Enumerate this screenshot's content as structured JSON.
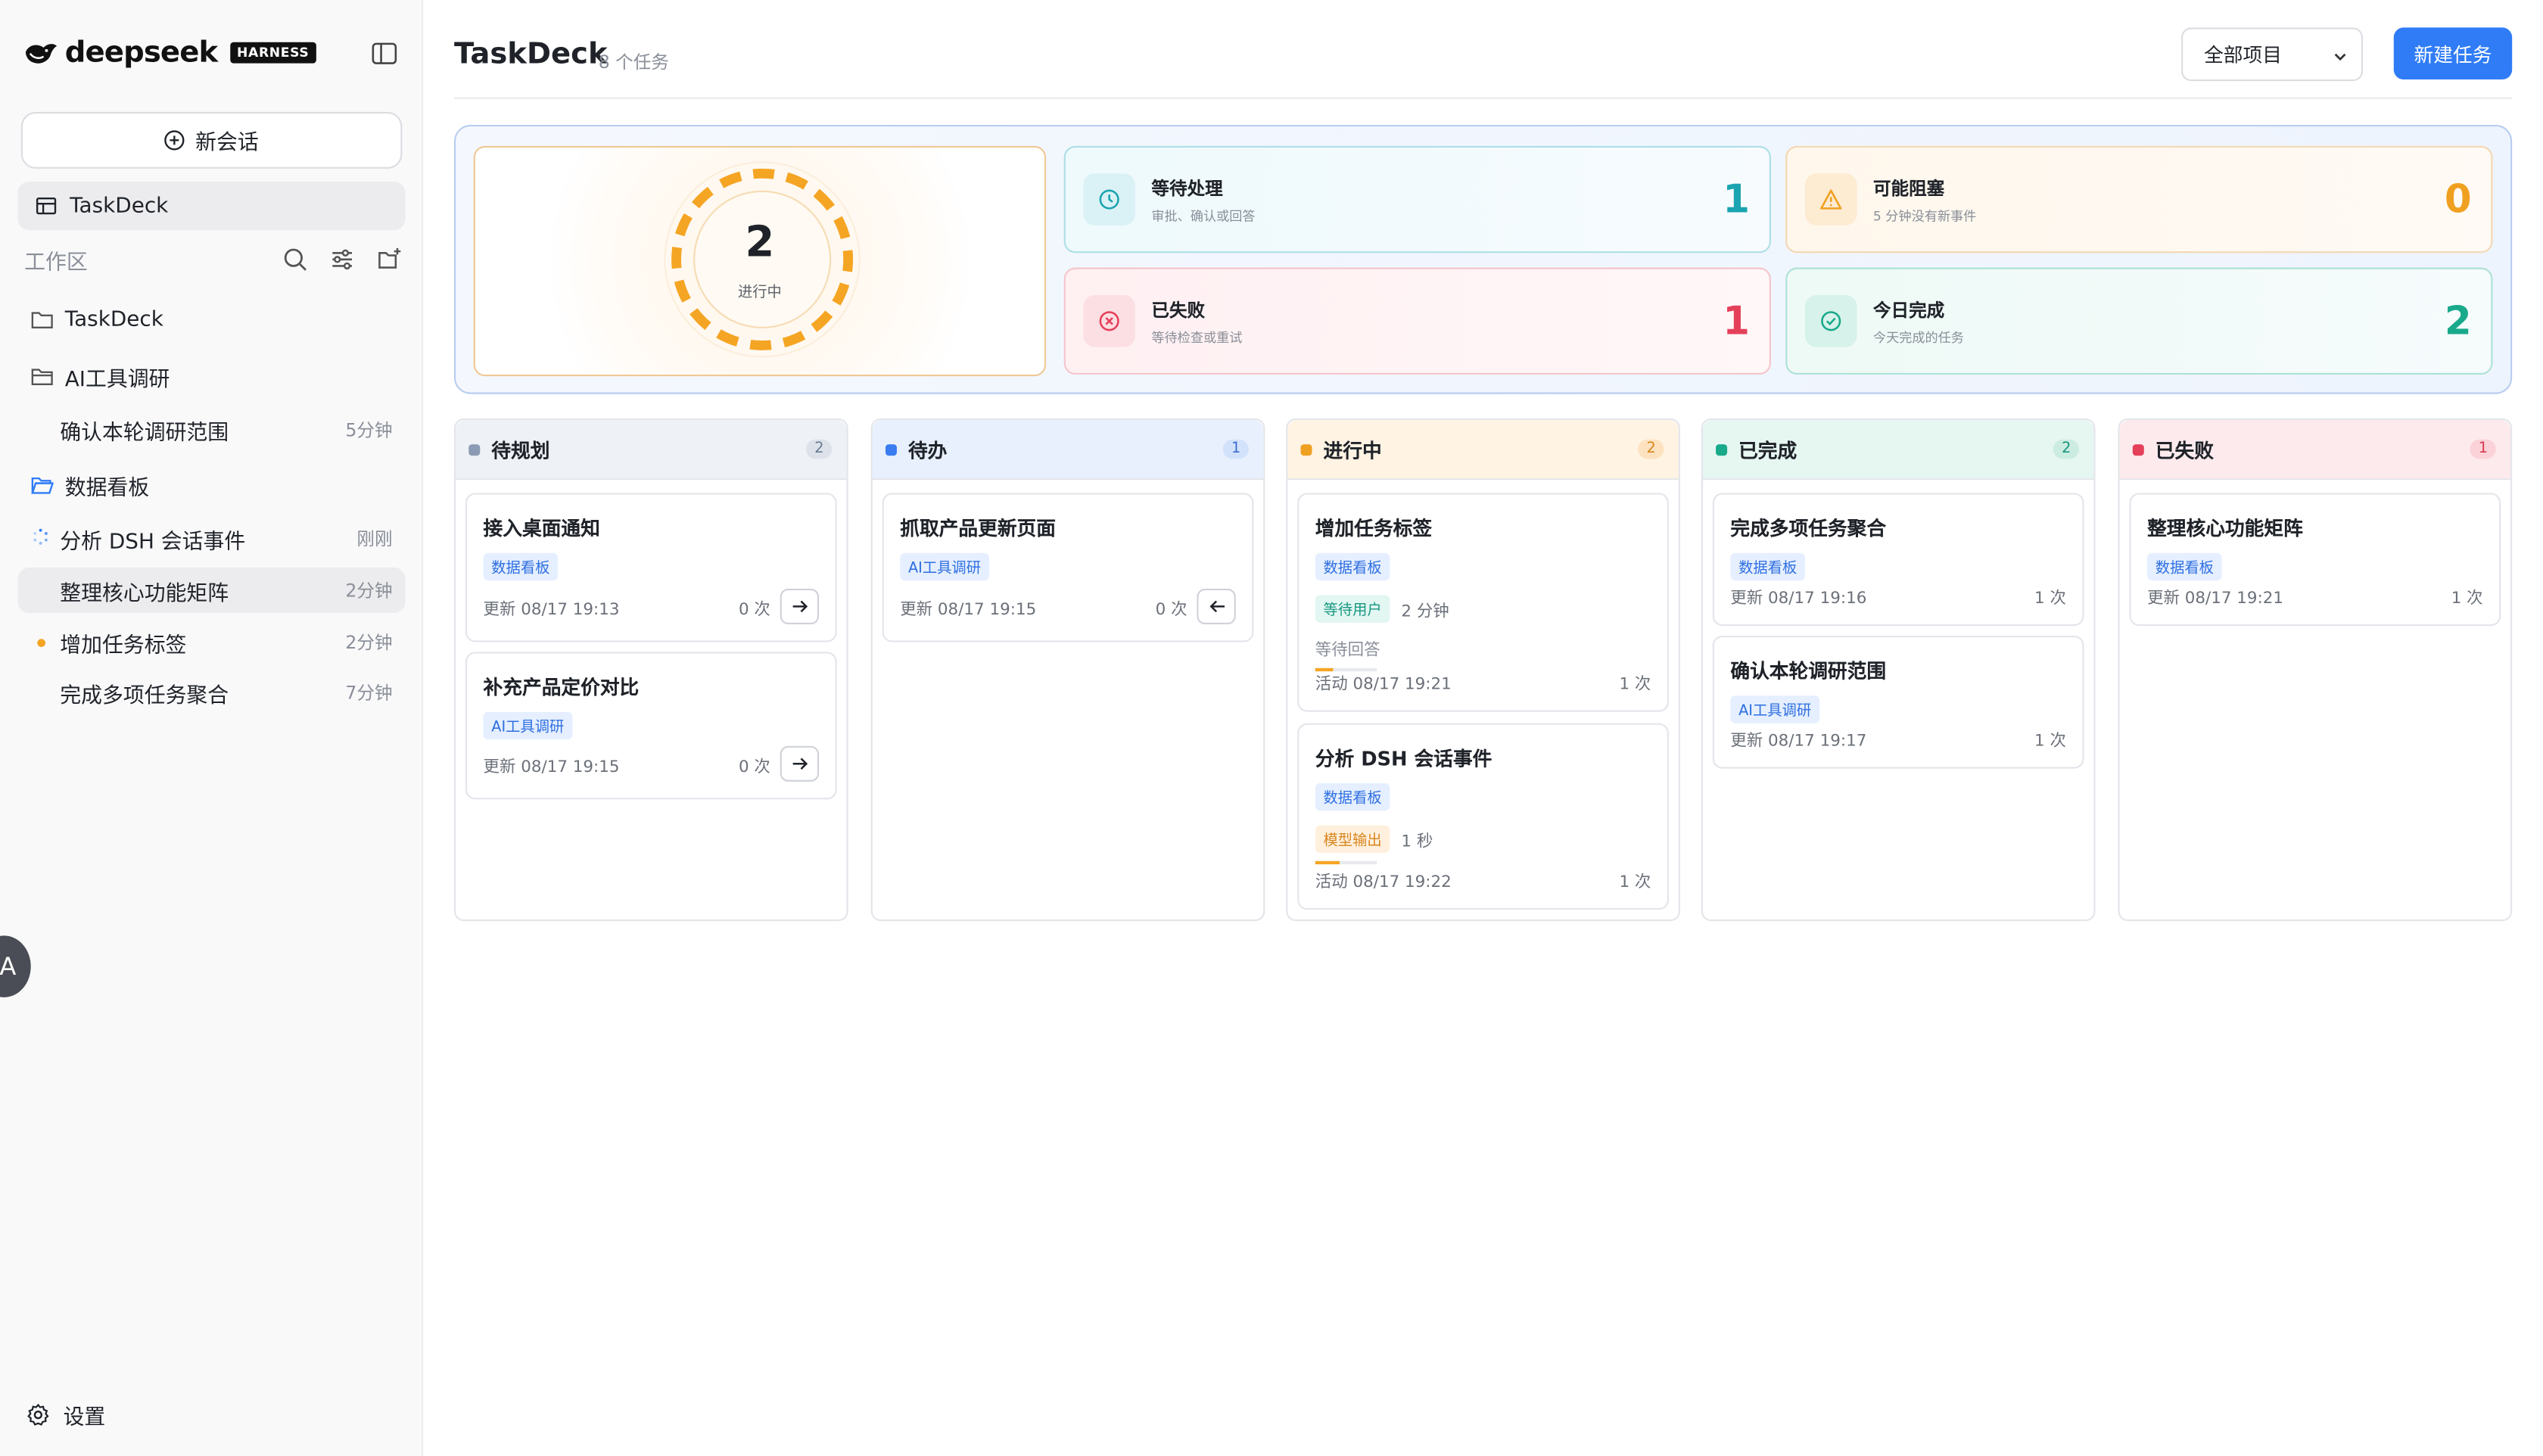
{
  "brand": {
    "name": "deepseek",
    "badge": "HARNESS"
  },
  "sidebar": {
    "new_chat": "新会话",
    "nav_taskdeck": "TaskDeck",
    "workspace_label": "工作区",
    "tree": [
      {
        "label": "TaskDeck",
        "type": "folder"
      },
      {
        "label": "AI工具调研",
        "type": "folder"
      },
      {
        "label": "确认本轮调研范围",
        "time": "5分钟",
        "type": "child"
      },
      {
        "label": "数据看板",
        "type": "folder-open"
      },
      {
        "label": "分析 DSH 会话事件",
        "time": "刚刚",
        "type": "child"
      },
      {
        "label": "整理核心功能矩阵",
        "time": "2分钟",
        "type": "child"
      },
      {
        "label": "增加任务标签",
        "time": "2分钟",
        "type": "child"
      },
      {
        "label": "完成多项任务聚合",
        "time": "7分钟",
        "type": "child"
      }
    ],
    "avatar_letter": "A",
    "settings": "设置"
  },
  "header": {
    "title": "TaskDeck",
    "task_count": "8 个任务",
    "project_select": "全部项目",
    "new_task": "新建任务"
  },
  "stats": {
    "ring": {
      "value": "2",
      "label": "进行中"
    },
    "waiting": {
      "title": "等待处理",
      "sub": "审批、确认或回答",
      "value": "1",
      "color": "#1aa3b0"
    },
    "blocked": {
      "title": "可能阻塞",
      "sub": "5 分钟没有新事件",
      "value": "0",
      "color": "#f0a020"
    },
    "failed": {
      "title": "已失败",
      "sub": "等待检查或重试",
      "value": "1",
      "color": "#e5405a"
    },
    "done": {
      "title": "今日完成",
      "sub": "今天完成的任务",
      "value": "2",
      "color": "#19a98b"
    }
  },
  "columns": [
    {
      "title": "待规划",
      "count": "2",
      "color": "#8b9bb4",
      "head_bg": "#eef1f6",
      "count_bg": "#dde2ea",
      "count_fg": "#6b7a92",
      "cards": [
        {
          "title": "接入桌面通知",
          "tag": "数据看板",
          "foot": "更新 08/17 19:13",
          "count": "0 次",
          "arrow": "→"
        },
        {
          "title": "补充产品定价对比",
          "tag": "AI工具调研",
          "foot": "更新 08/17 19:15",
          "count": "0 次",
          "arrow": "→"
        }
      ]
    },
    {
      "title": "待办",
      "count": "1",
      "color": "#3a7df0",
      "head_bg": "#e8f0fd",
      "count_bg": "#d3e2fb",
      "count_fg": "#3a6fd0",
      "cards": [
        {
          "title": "抓取产品更新页面",
          "tag": "AI工具调研",
          "foot": "更新 08/17 19:15",
          "count": "0 次",
          "arrow": "←"
        }
      ]
    },
    {
      "title": "进行中",
      "count": "2",
      "color": "#f0a020",
      "head_bg": "#fff3e3",
      "count_bg": "#fde2bf",
      "count_fg": "#d9861e",
      "cards": [
        {
          "title": "增加任务标签",
          "tag": "数据看板",
          "status": "等待用户",
          "duration": "2 分钟",
          "note": "等待回答",
          "progress": 0.3,
          "foot": "活动 08/17 19:21",
          "count": "1 次"
        },
        {
          "title": "分析 DSH 会话事件",
          "tag": "数据看板",
          "status": "模型输出",
          "duration": "1 秒",
          "progress": 0.4,
          "foot": "活动 08/17 19:22",
          "count": "1 次"
        }
      ]
    },
    {
      "title": "已完成",
      "count": "2",
      "color": "#19a98b",
      "head_bg": "#e6f6f1",
      "count_bg": "#ccece2",
      "count_fg": "#19977d",
      "cards": [
        {
          "title": "完成多项任务聚合",
          "tag": "数据看板",
          "foot": "更新 08/17 19:16",
          "count": "1 次"
        },
        {
          "title": "确认本轮调研范围",
          "tag": "AI工具调研",
          "foot": "更新 08/17 19:17",
          "count": "1 次"
        }
      ]
    },
    {
      "title": "已失败",
      "count": "1",
      "color": "#e5405a",
      "head_bg": "#fdeaed",
      "count_bg": "#fad2d8",
      "count_fg": "#d83a52",
      "cards": [
        {
          "title": "整理核心功能矩阵",
          "tag": "数据看板",
          "foot": "更新 08/17 19:21",
          "count": "1 次"
        }
      ]
    }
  ]
}
